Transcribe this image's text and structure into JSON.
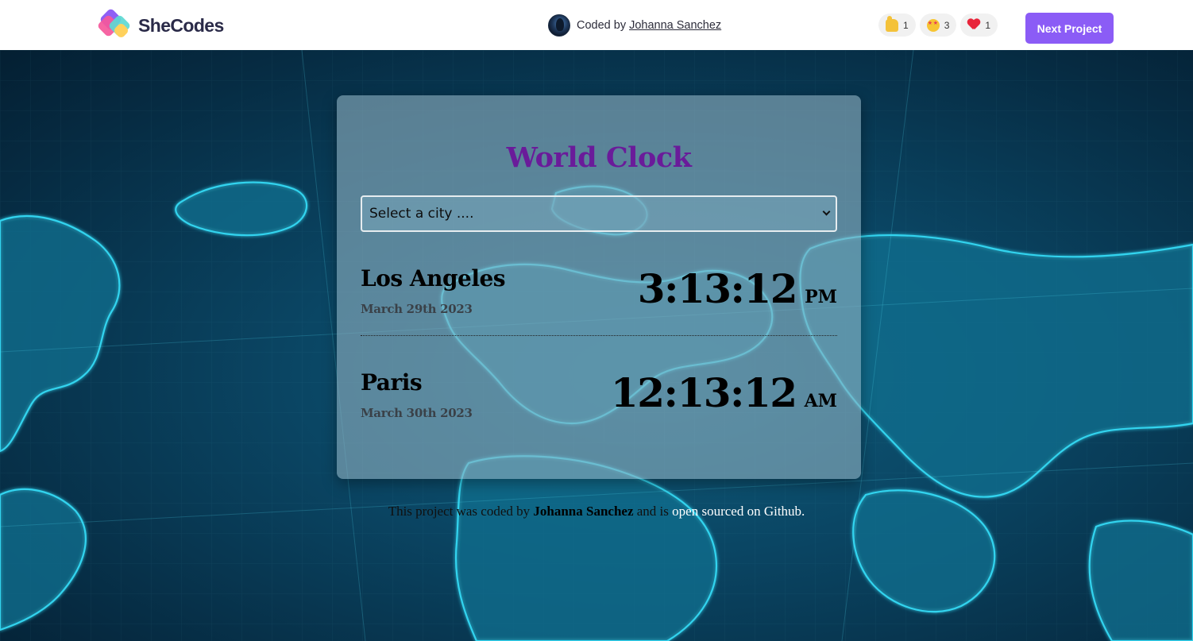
{
  "header": {
    "logo_text": "SheCodes",
    "coded_by_label": "Coded by",
    "author_name": "Johanna Sanchez",
    "reactions": [
      {
        "icon": "thumbs-up-icon",
        "count": "1"
      },
      {
        "icon": "star-struck-icon",
        "count": "3"
      },
      {
        "icon": "heart-icon",
        "count": "1"
      }
    ],
    "next_button_label": "Next Project",
    "accent_color": "#8b5cf6"
  },
  "app": {
    "title": "World Clock",
    "title_color": "#6a1b9a",
    "city_select": {
      "selected": "Select a city ...."
    },
    "cities": [
      {
        "name": "Los Angeles",
        "date": "March 29th 2023",
        "time": "3:13:12",
        "ampm": "PM"
      },
      {
        "name": "Paris",
        "date": "March 30th 2023",
        "time": "12:13:12",
        "ampm": "AM"
      }
    ]
  },
  "footer": {
    "prefix": "This project was coded by",
    "author": "Johanna Sanchez",
    "middle": "and is",
    "link_text": "open sourced on Github."
  }
}
